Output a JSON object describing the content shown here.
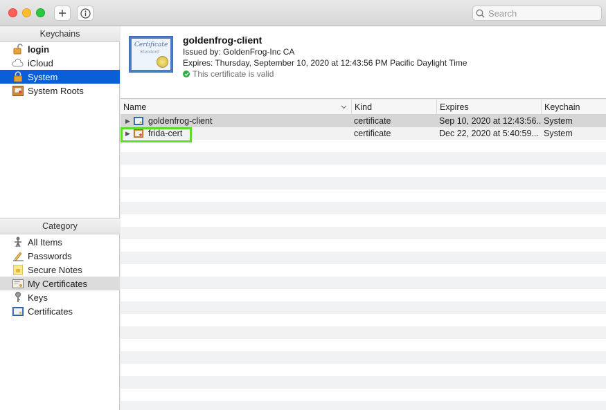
{
  "toolbar": {
    "add_icon": "plus-icon",
    "info_icon": "info-icon",
    "search_placeholder": "Search"
  },
  "sidebar": {
    "keychains_header": "Keychains",
    "keychains": [
      {
        "label": "login",
        "icon": "lock-open-icon",
        "bold": true
      },
      {
        "label": "iCloud",
        "icon": "cloud-icon"
      },
      {
        "label": "System",
        "icon": "lock-icon",
        "selected": true
      },
      {
        "label": "System Roots",
        "icon": "certificate-cabinet-icon"
      }
    ],
    "category_header": "Category",
    "categories": [
      {
        "label": "All Items",
        "icon": "all-items-icon"
      },
      {
        "label": "Passwords",
        "icon": "pencil-icon"
      },
      {
        "label": "Secure Notes",
        "icon": "note-icon"
      },
      {
        "label": "My Certificates",
        "icon": "my-certificate-icon",
        "selected": true
      },
      {
        "label": "Keys",
        "icon": "key-icon"
      },
      {
        "label": "Certificates",
        "icon": "certificate-icon"
      }
    ]
  },
  "info": {
    "title": "goldenfrog-client",
    "issued_by": "Issued by: GoldenFrog-Inc CA",
    "expires": "Expires: Thursday, September 10, 2020 at 12:43:56 PM Pacific Daylight Time",
    "valid": "This certificate is valid",
    "cert_text": "Certificate",
    "cert_subtext": "Standard"
  },
  "table": {
    "columns": [
      "Name",
      "Kind",
      "Expires",
      "Keychain"
    ],
    "rows": [
      {
        "name": "goldenfrog-client",
        "kind": "certificate",
        "expires": "Sep 10, 2020 at 12:43:56...",
        "keychain": "System"
      },
      {
        "name": "frida-cert",
        "kind": "certificate",
        "expires": "Dec 22, 2020 at 5:40:59...",
        "keychain": "System"
      }
    ]
  },
  "colors": {
    "selection": "#0a5fd6",
    "highlight": "#5fdb2a",
    "valid": "#2bb041"
  }
}
